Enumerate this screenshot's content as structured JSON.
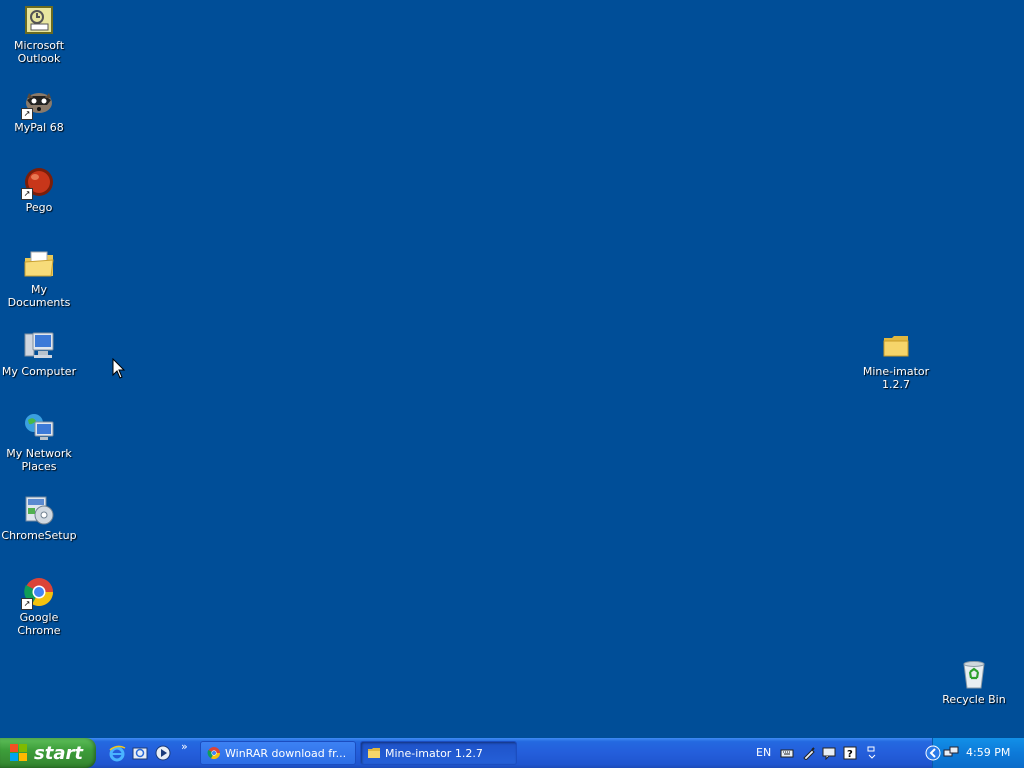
{
  "desktop": {
    "background_color": "#004e98",
    "icons_left": [
      {
        "label": "Microsoft Outlook",
        "icon": "outlook-icon"
      },
      {
        "label": "MyPal 68",
        "icon": "mypal-icon"
      },
      {
        "label": "Pego",
        "icon": "pego-icon"
      },
      {
        "label": "My Documents",
        "icon": "my-documents-icon"
      },
      {
        "label": "My Computer",
        "icon": "my-computer-icon"
      },
      {
        "label": "My Network Places",
        "icon": "network-places-icon"
      },
      {
        "label": "ChromeSetup",
        "icon": "chrome-setup-icon"
      },
      {
        "label": "Google Chrome",
        "icon": "chrome-icon"
      }
    ],
    "folder": {
      "label": "Mine-imator 1.2.7",
      "icon": "folder-icon"
    },
    "recycle_bin": {
      "label": "Recycle Bin",
      "icon": "recycle-bin-icon"
    }
  },
  "taskbar": {
    "start_label": "start",
    "quick_launch": [
      "internet-explorer-icon",
      "outlook-express-icon",
      "media-player-icon"
    ],
    "overflow_label": "»",
    "tasks": [
      {
        "label": "WinRAR download fr...",
        "icon": "chrome-icon",
        "active": false
      },
      {
        "label": "Mine-imator 1.2.7",
        "icon": "folder-icon",
        "active": true
      }
    ],
    "language": "EN",
    "clock": "4:59 PM"
  }
}
